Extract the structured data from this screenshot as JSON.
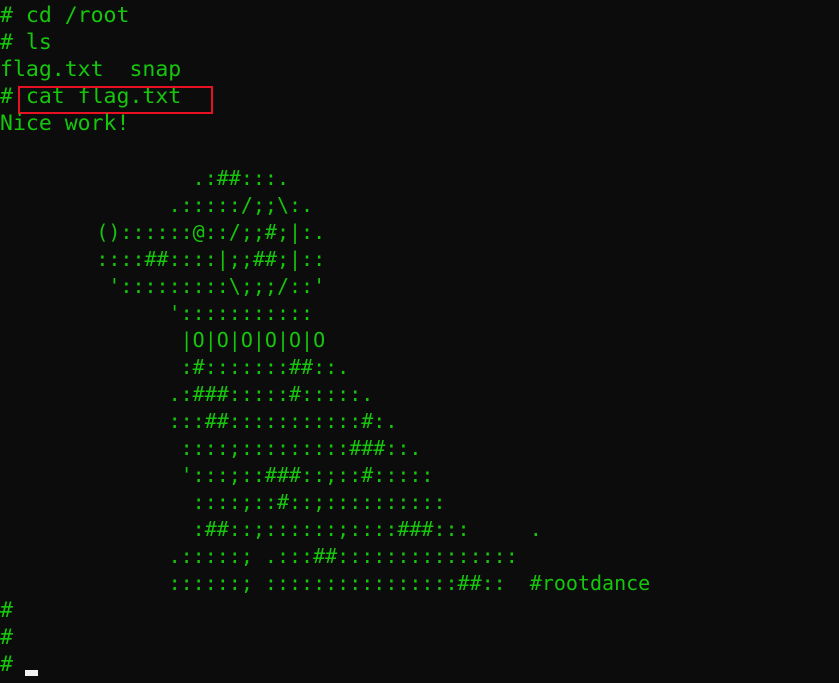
{
  "terminal": {
    "prompt": "#",
    "lines": [
      "# cd /root",
      "# ls",
      "flag.txt  snap",
      "# cat flag.txt",
      "Nice work!"
    ],
    "highlighted_command": "cat flag.txt",
    "ascii_art": [
      "                .:##:::.",
      "              .:::::/;;\\:.",
      "        ()::::::@::/;;#;|:.",
      "        ::::##::::|;;##;|::",
      "         ':::::::::\\;;;/::'",
      "              ':::::::::::",
      "               |O|O|O|O|O|O",
      "               :#:::::::##::.",
      "              .:###:::::#:::::.",
      "              :::##:::::::::::#:.",
      "               ::::;:::::::::###::.",
      "               ':::;::###::;::#:::::",
      "                ::::;::#::;::::::::::",
      "                :##::;::::::;::::###:::     .",
      "              .:::::; .:::##:::::::::::::::",
      "              ::::::; ::::::::::::::::##::  #rootdance"
    ],
    "trailing_prompts": [
      "#",
      "#",
      "#"
    ]
  },
  "colors": {
    "background": "#0c0c0c",
    "text": "#16c60c",
    "highlight_box": "#e81123",
    "cursor": "#f2f2f2"
  }
}
